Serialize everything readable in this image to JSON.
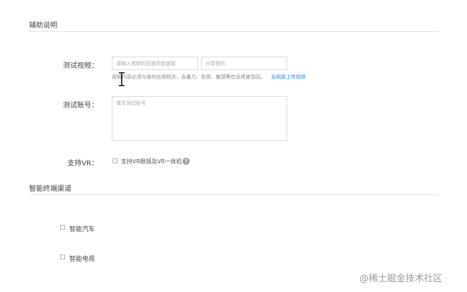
{
  "sections": {
    "aux": {
      "title": "辅助说明"
    },
    "smart": {
      "title": "智能终端渠道"
    }
  },
  "test_video": {
    "label": "测试视频：",
    "link_placeholder": "请输入视频的百度网盘链接",
    "code_placeholder": "分享密码",
    "hint": "视频内容必须与操作应用相关，含暴力、色情、敏感等信息将被驳回。",
    "upload_link": "去网盘上传视频"
  },
  "test_account": {
    "label": "测试账号：",
    "placeholder": "填写测试账号"
  },
  "vr": {
    "label": "支持VR：",
    "checkbox_label": "支持VR眼镜及VR一体机",
    "help": "?"
  },
  "smart_channels": [
    {
      "label": "智能汽车"
    },
    {
      "label": "智能电视"
    }
  ],
  "watermark": "@稀土掘金技术社区",
  "icons": {
    "cursor": "text-cursor-icon",
    "help": "question-circle-icon"
  }
}
